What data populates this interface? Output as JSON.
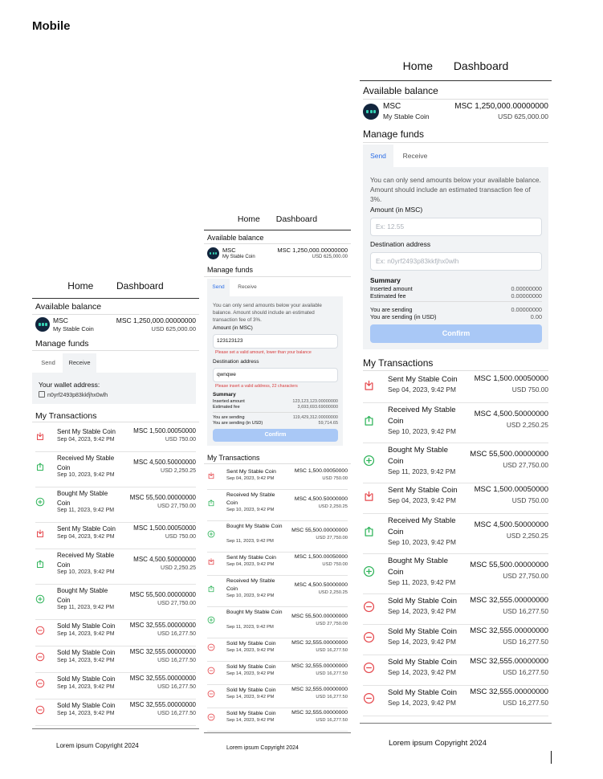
{
  "page_label": "Mobile",
  "nav": {
    "home": "Home",
    "dashboard": "Dashboard"
  },
  "balance": {
    "heading": "Available balance",
    "code": "MSC",
    "name": "My Stable Coin",
    "amount": "MSC 1,250,000.00000000",
    "usd": "USD 625,000.00"
  },
  "funds": {
    "heading": "Manage funds",
    "tab_send": "Send",
    "tab_receive": "Receive",
    "wallet_label": "Your wallet address:",
    "wallet_address": "n0yrf2493p83kkfjhx0wlh",
    "notice": "You can only send amounts below your available balance. Amount should include an estimated transaction fee of 3%.",
    "amount_label": "Amount (in MSC)",
    "amount_placeholder": "Ex: 12.55",
    "amount_value": "123123123",
    "amount_error": "Please set a valid amount, lower than your balance",
    "dest_label": "Destination address",
    "dest_placeholder": "Ex: n0yrf2493p83kkfjhx0wlh",
    "dest_value": "qwnqwe",
    "dest_error": "Please insert a valid address, 22 characters",
    "summary_label": "Summary",
    "inserted_label": "Inserted amount",
    "fee_label": "Estimated fee",
    "sending_label": "You are sending",
    "sending_usd_label": "You are sending (in USD)",
    "inserted_empty": "0.00000000",
    "fee_empty": "0.00000000",
    "sending_empty": "0.00000000",
    "sending_usd_empty": "0.00",
    "inserted_filled": "123,123,123.00000000",
    "fee_filled": "3,693,693.69000000",
    "sending_filled": "119,429,312.00000000",
    "sending_usd_filled": "59,714.65",
    "confirm": "Confirm"
  },
  "transactions_heading": "My Transactions",
  "transactions": [
    {
      "type": "sent",
      "title": "Sent My Stable Coin",
      "date": "Sep 04, 2023, 9:42 PM",
      "amount": "MSC 1,500.00050000",
      "usd": "USD 750.00"
    },
    {
      "type": "received",
      "title": "Received My Stable Coin",
      "date": "Sep 10, 2023, 9:42 PM",
      "amount": "MSC 4,500.50000000",
      "usd": "USD 2,250.25"
    },
    {
      "type": "bought",
      "title": "Bought My Stable Coin",
      "date": "Sep 11, 2023, 9:42 PM",
      "amount": "MSC 55,500.00000000",
      "usd": "USD 27,750.00"
    },
    {
      "type": "sent",
      "title": "Sent My Stable Coin",
      "date": "Sep 04, 2023, 9:42 PM",
      "amount": "MSC 1,500.00050000",
      "usd": "USD 750.00"
    },
    {
      "type": "received",
      "title": "Received My Stable Coin",
      "date": "Sep 10, 2023, 9:42 PM",
      "amount": "MSC 4,500.50000000",
      "usd": "USD 2,250.25"
    },
    {
      "type": "bought",
      "title": "Bought My Stable Coin",
      "date": "Sep 11, 2023, 9:42 PM",
      "amount": "MSC 55,500.00000000",
      "usd": "USD 27,750.00"
    },
    {
      "type": "sold",
      "title": "Sold My Stable Coin",
      "date": "Sep 14, 2023, 9:42 PM",
      "amount": "MSC 32,555.00000000",
      "usd": "USD 16,277.50"
    },
    {
      "type": "sold",
      "title": "Sold My Stable Coin",
      "date": "Sep 14, 2023, 9:42 PM",
      "amount": "MSC 32,555.00000000",
      "usd": "USD 16,277.50"
    },
    {
      "type": "sold",
      "title": "Sold My Stable Coin",
      "date": "Sep 14, 2023, 9:42 PM",
      "amount": "MSC 32,555.00000000",
      "usd": "USD 16,277.50"
    },
    {
      "type": "sold",
      "title": "Sold My Stable Coin",
      "date": "Sep 14, 2023, 9:42 PM",
      "amount": "MSC 32,555.00000000",
      "usd": "USD 16,277.50"
    }
  ],
  "footer": "Lorem ipsum Copyright 2024",
  "colors": {
    "sent": "#e5484d",
    "received": "#2fb45a",
    "bought": "#2fb45a",
    "sold": "#e5484d",
    "accent": "#2d6ee6",
    "button": "#a9c8f6"
  },
  "icons": {
    "sent": "download-tray-icon",
    "received": "upload-tray-icon",
    "bought": "plus-circle-icon",
    "sold": "minus-circle-icon",
    "coin": "coin-logo-icon",
    "copy": "copy-icon"
  }
}
